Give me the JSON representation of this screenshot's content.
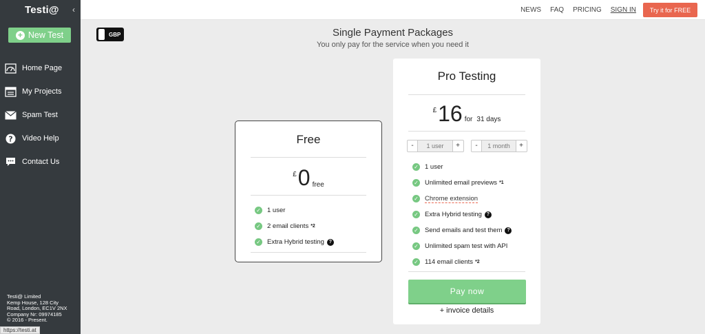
{
  "sidebar": {
    "logo": "Testi@",
    "collapse_icon": "chevron-left",
    "new_test_label": "New Test",
    "items": [
      {
        "label": "Home Page",
        "icon": "dashboard-icon"
      },
      {
        "label": "My Projects",
        "icon": "projects-icon"
      },
      {
        "label": "Spam Test",
        "icon": "envelope-icon"
      },
      {
        "label": "Video Help",
        "icon": "help-icon"
      },
      {
        "label": "Contact Us",
        "icon": "chat-icon"
      }
    ],
    "footer": {
      "line1": "Testi@ Limited",
      "line2": "Kemp House, 128 City",
      "line3": "Road, London, EC1V 2NX",
      "line4": "Company Nr: 09974185",
      "line5": "© 2016 - Present."
    },
    "status_url": "https://testi.at"
  },
  "topnav": {
    "items": [
      "NEWS",
      "FAQ",
      "PRICING",
      "SIGN IN"
    ],
    "cta": "Try it for FREE"
  },
  "currency_toggle": "GBP",
  "heading": {
    "title": "Single Payment Packages",
    "subtitle": "You only pay for the service when you need it"
  },
  "free_plan": {
    "name": "Free",
    "currency": "£",
    "price": "0",
    "suffix": "free",
    "features": [
      {
        "text": "1 user",
        "note": "",
        "help": false
      },
      {
        "text": "2 email clients",
        "note": "*2",
        "help": false
      },
      {
        "text": "Extra Hybrid testing",
        "note": "",
        "help": true
      }
    ]
  },
  "pro_plan": {
    "name": "Pro Testing",
    "currency": "£",
    "price": "16",
    "suffix_for": "for",
    "suffix_days": "31 days",
    "users_stepper": {
      "minus": "-",
      "value": "1 user",
      "plus": "+"
    },
    "months_stepper": {
      "minus": "-",
      "value": "1 month",
      "plus": "+"
    },
    "features": [
      {
        "text": "1 user",
        "note": "",
        "help": false
      },
      {
        "text": "Unlimited email previews",
        "note": "*1",
        "help": false
      },
      {
        "text": "Chrome extension",
        "note": "",
        "help": false
      },
      {
        "text": "Extra Hybrid testing",
        "note": "",
        "help": true
      },
      {
        "text": "Send emails and test them",
        "note": "",
        "help": true
      },
      {
        "text": "Unlimited spam test with API",
        "note": "",
        "help": false
      },
      {
        "text": "114 email clients",
        "note": "*2",
        "help": false
      }
    ],
    "pay_button": "Pay now",
    "invoice_link": "+ invoice details"
  },
  "colors": {
    "sidebar_bg": "#353a3e",
    "green": "#7fd08a",
    "cta": "#e9664f"
  }
}
